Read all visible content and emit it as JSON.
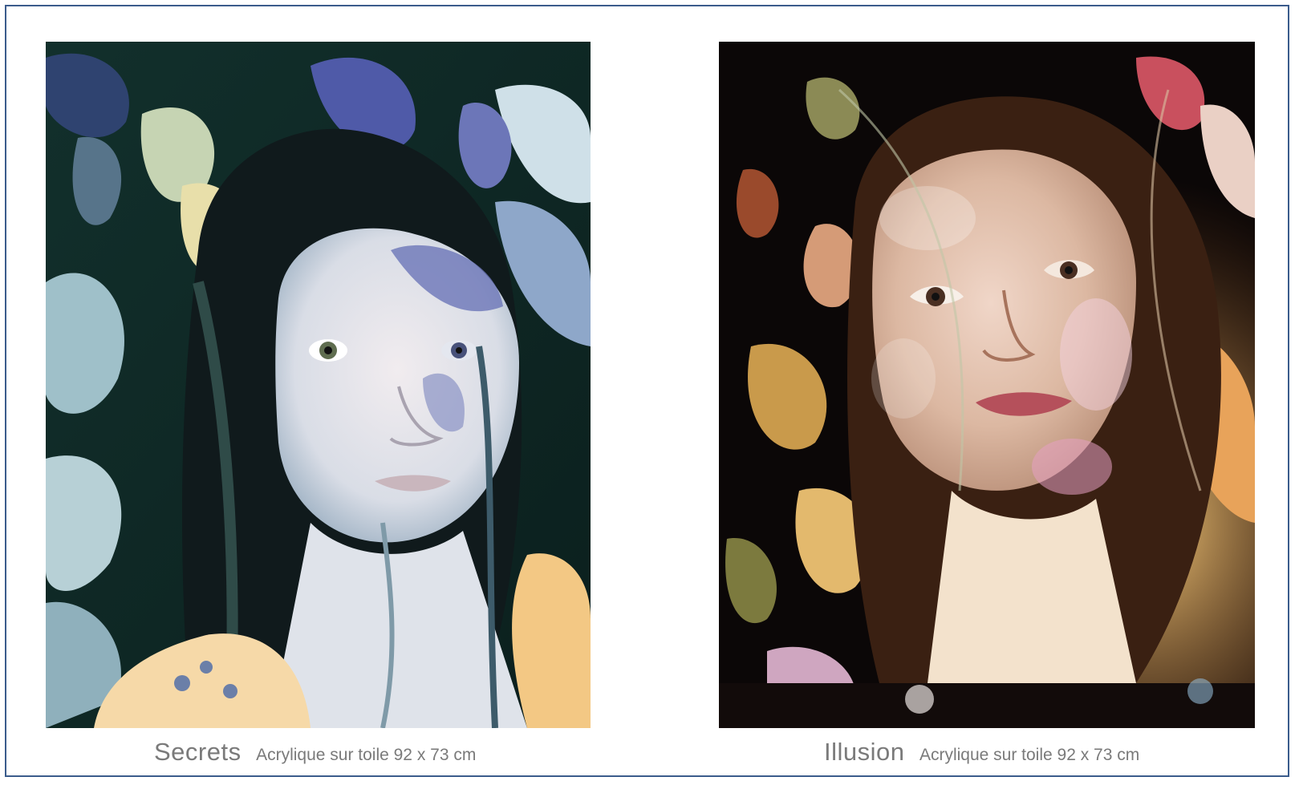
{
  "colors": {
    "border": "#3b5c8c",
    "caption_text": "#7a7a7a",
    "background": "#ffffff"
  },
  "artworks": [
    {
      "title": "Secrets",
      "medium": "Acrylique sur toile 92 x 73 cm",
      "palette": [
        "#0e2a26",
        "#1d3b3a",
        "#9fc0c9",
        "#6c76b8",
        "#e9e3e6",
        "#f6c98a"
      ]
    },
    {
      "title": "Illusion",
      "medium": "Acrylique sur toile 92 x 73 cm",
      "palette": [
        "#0b0707",
        "#3a2012",
        "#d89b63",
        "#e8c2b2",
        "#c96a78",
        "#f3e2cc"
      ]
    }
  ]
}
